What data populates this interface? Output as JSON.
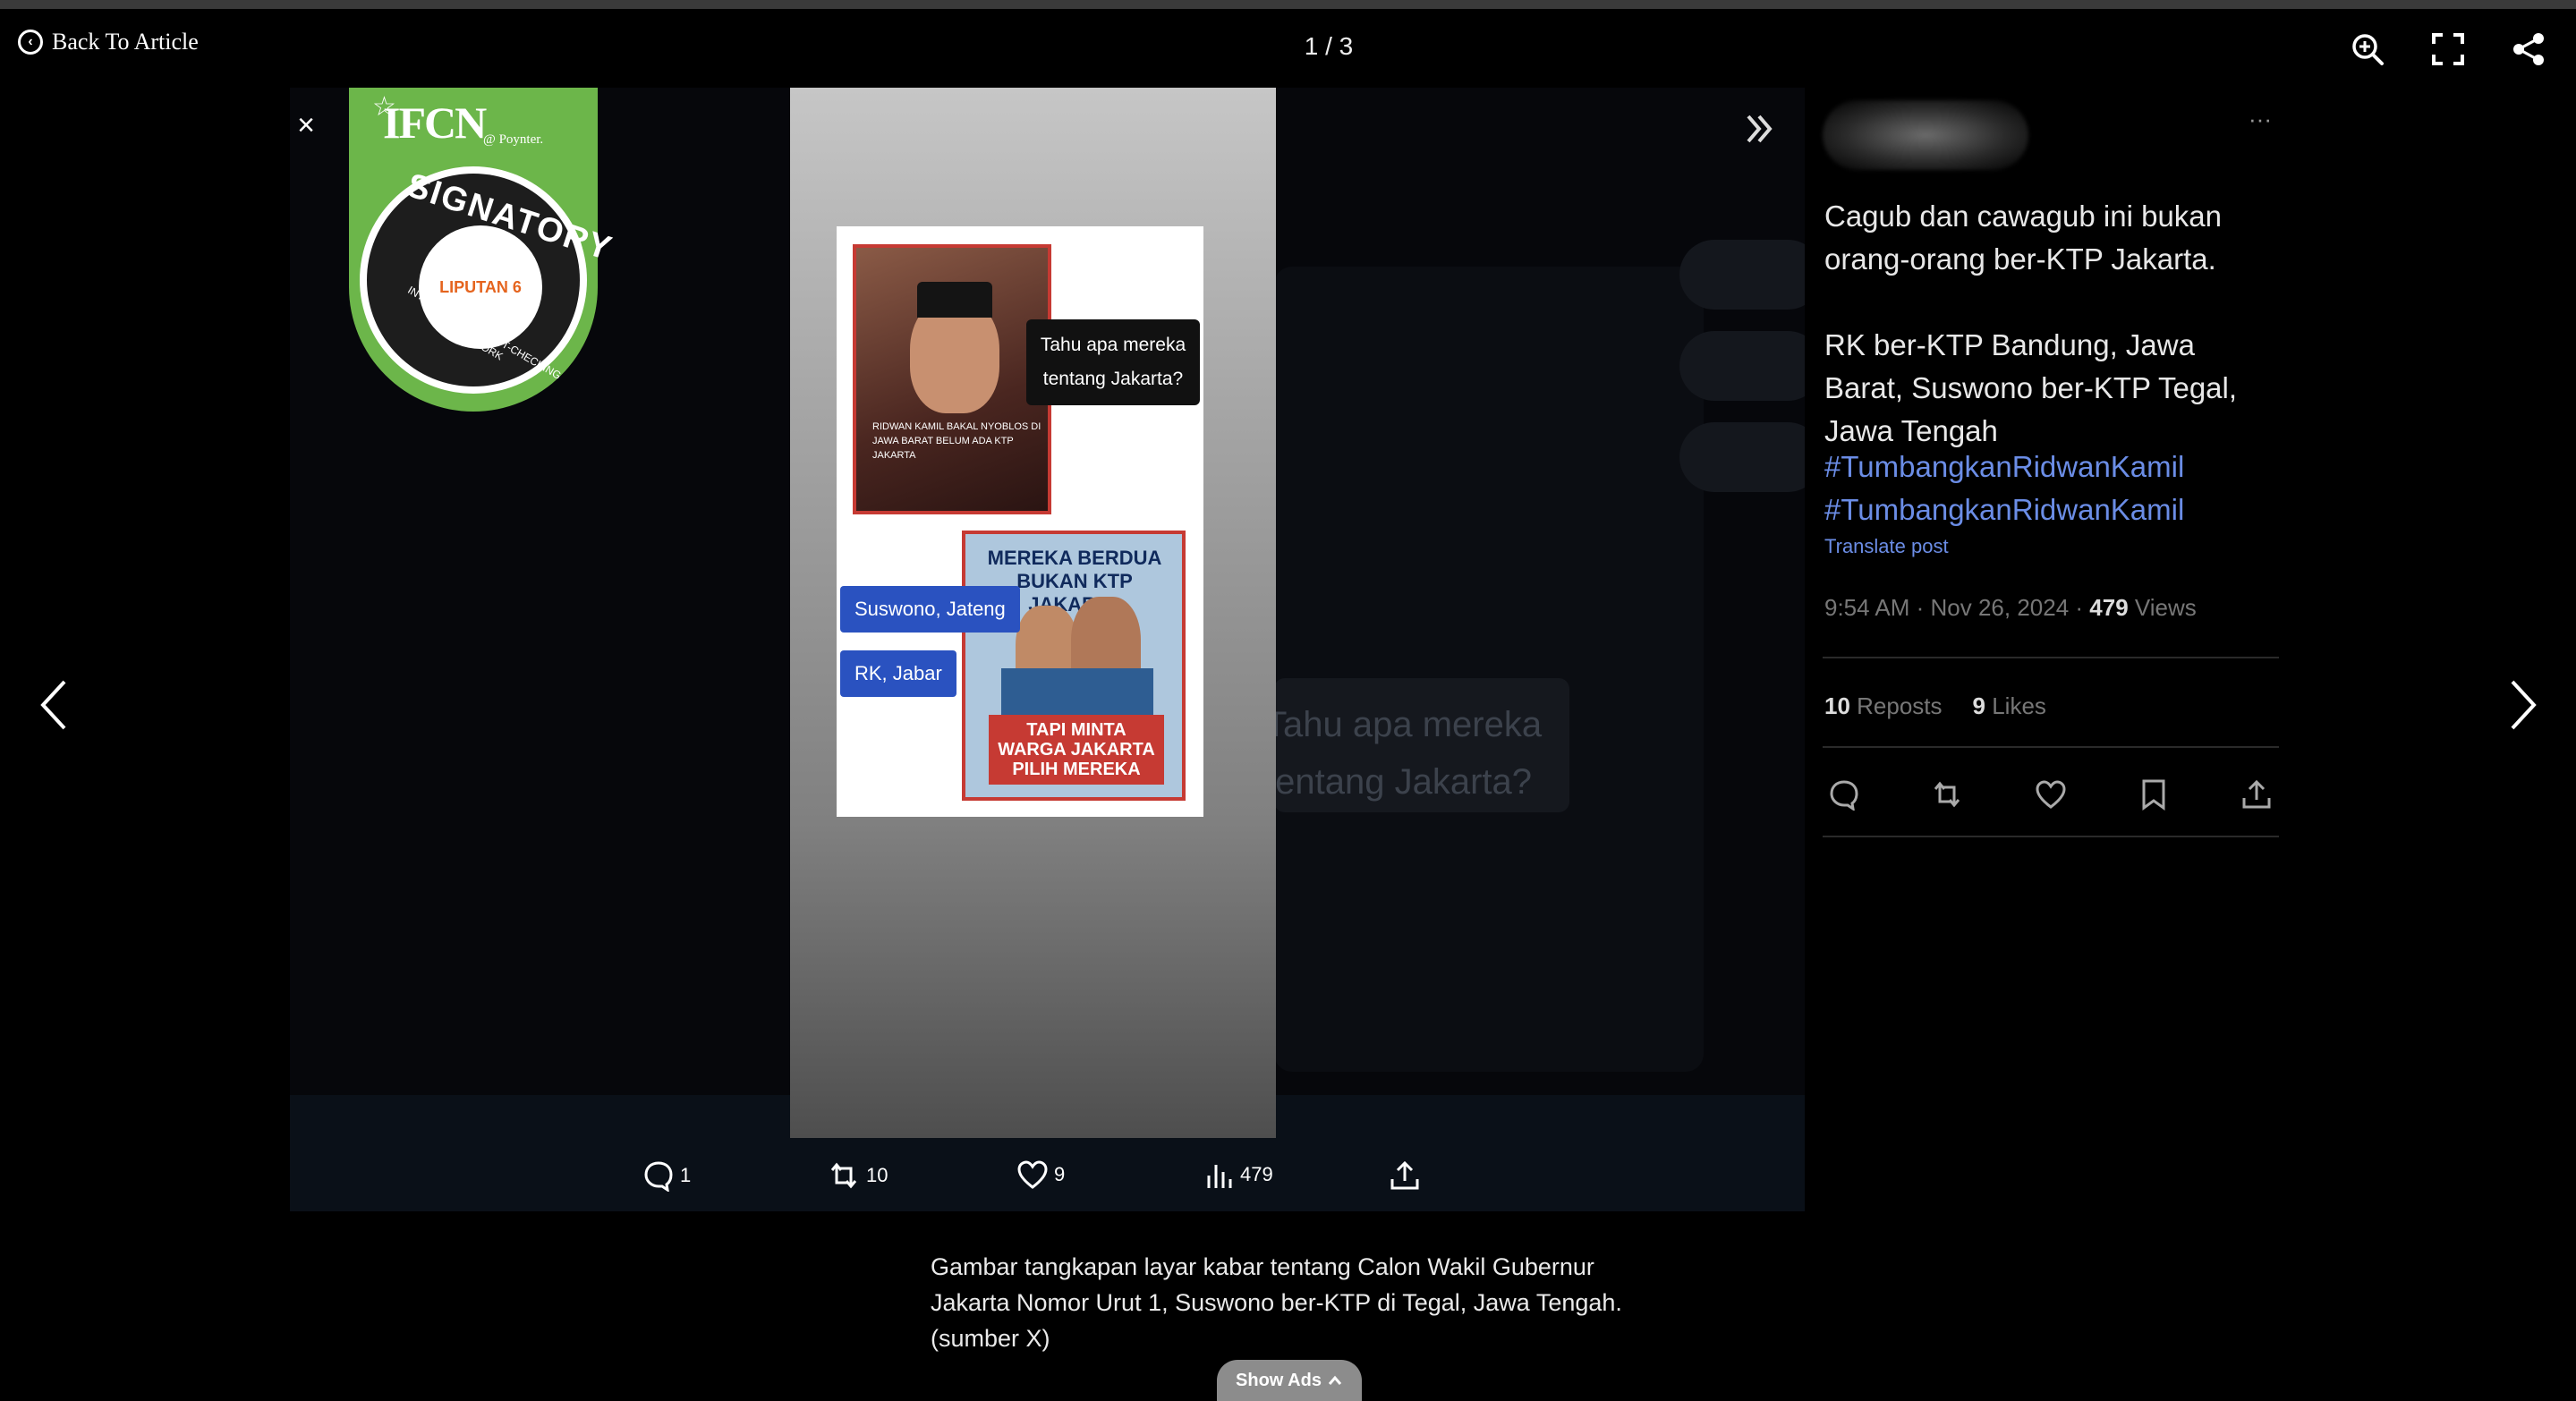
{
  "toolbar": {
    "back_label": "Back To Article",
    "counter": "1 / 3"
  },
  "ifcn_badge": {
    "top": "IFCN",
    "publisher": "@ Poynter.",
    "signatory": "SIGNATORY",
    "network": "INTERNATIONAL FACT-CHECKING NETWORK",
    "org": "LIPUTAN 6"
  },
  "phone_card": {
    "photo_caption": "RIDWAN KAMIL BAKAL NYOBLOS DI JAWA BARAT BELUM ADA KTP JAKARTA",
    "bubble_text": "Tahu apa mereka tentang Jakarta?",
    "poster_heading": "MEREKA BERDUA BUKAN KTP JAKARTA",
    "poster_tagline": "TAPI MINTA WARGA JAKARTA PILIH MEREKA",
    "chip_suswono": "Suswono, Jateng",
    "chip_rk": "RK, Jabar"
  },
  "background_ghost": {
    "text": "Tahu apa mereka tentang Jakarta?"
  },
  "phone_actions": {
    "replies": "1",
    "reposts": "10",
    "likes": "9",
    "views": "479"
  },
  "tweet": {
    "more": "···",
    "text_1": "Cagub dan cawagub ini bukan orang-orang ber-KTP Jakarta.",
    "text_2": "RK ber-KTP Bandung, Jawa Barat, Suswono ber-KTP Tegal, Jawa Tengah",
    "hashtag_1": "#TumbangkanRidwanKamil",
    "hashtag_2": "#TumbangkanRidwanKamil",
    "translate": "Translate post",
    "timestamp": "9:54 AM · Nov 26, 2024 · ",
    "views_count": "479",
    "views_label": " Views",
    "reposts_count": "10",
    "reposts_label": " Reposts",
    "likes_count": "9",
    "likes_label": " Likes"
  },
  "caption": {
    "text": "Gambar tangkapan layar kabar tentang Calon Wakil Gubernur Jakarta Nomor Urut 1, Suswono ber-KTP di Tegal, Jawa Tengah. (sumber X)"
  },
  "show_ads": {
    "label": "Show Ads"
  },
  "icons": {
    "back": "back-circle-icon",
    "zoom": "zoom-in-icon",
    "fullscreen": "fullscreen-icon",
    "share": "share-icon",
    "prev": "chevron-left-icon",
    "next": "chevron-right-icon"
  },
  "colors": {
    "background": "#000000",
    "hashtag": "#6b8de6",
    "ifcn_green": "#6cb64a",
    "chip_blue": "#2a52c0",
    "poster_red": "#c63a33",
    "show_ads_bg": "#8c8c8c"
  }
}
